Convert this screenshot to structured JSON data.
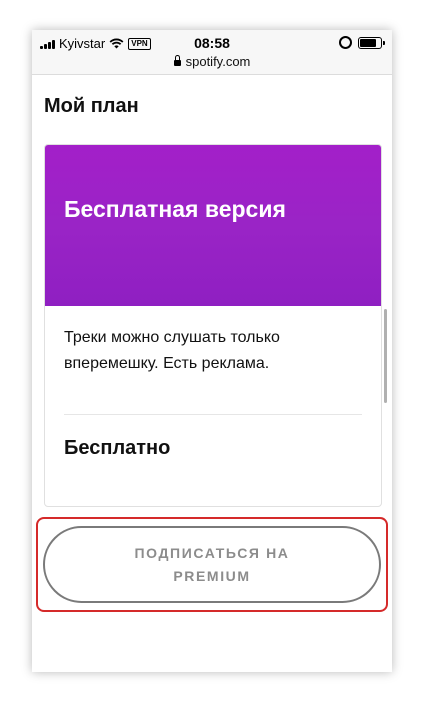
{
  "statusbar": {
    "carrier": "Kyivstar",
    "vpn_label": "VPN",
    "time": "08:58",
    "url": "spotify.com",
    "icons": [
      "signal-icon",
      "wifi-icon",
      "lock-icon",
      "alarm-icon",
      "battery-icon"
    ]
  },
  "page": {
    "title": "Мой план"
  },
  "plan": {
    "name": "Бесплатная версия",
    "description": "Треки можно слушать только вперемешку. Есть реклама.",
    "price": "Бесплатно",
    "header_color": "#9b22c7"
  },
  "cta": {
    "label": "ПОДПИСАТЬСЯ НА PREMIUM",
    "highlight_color": "#d52a2a"
  }
}
